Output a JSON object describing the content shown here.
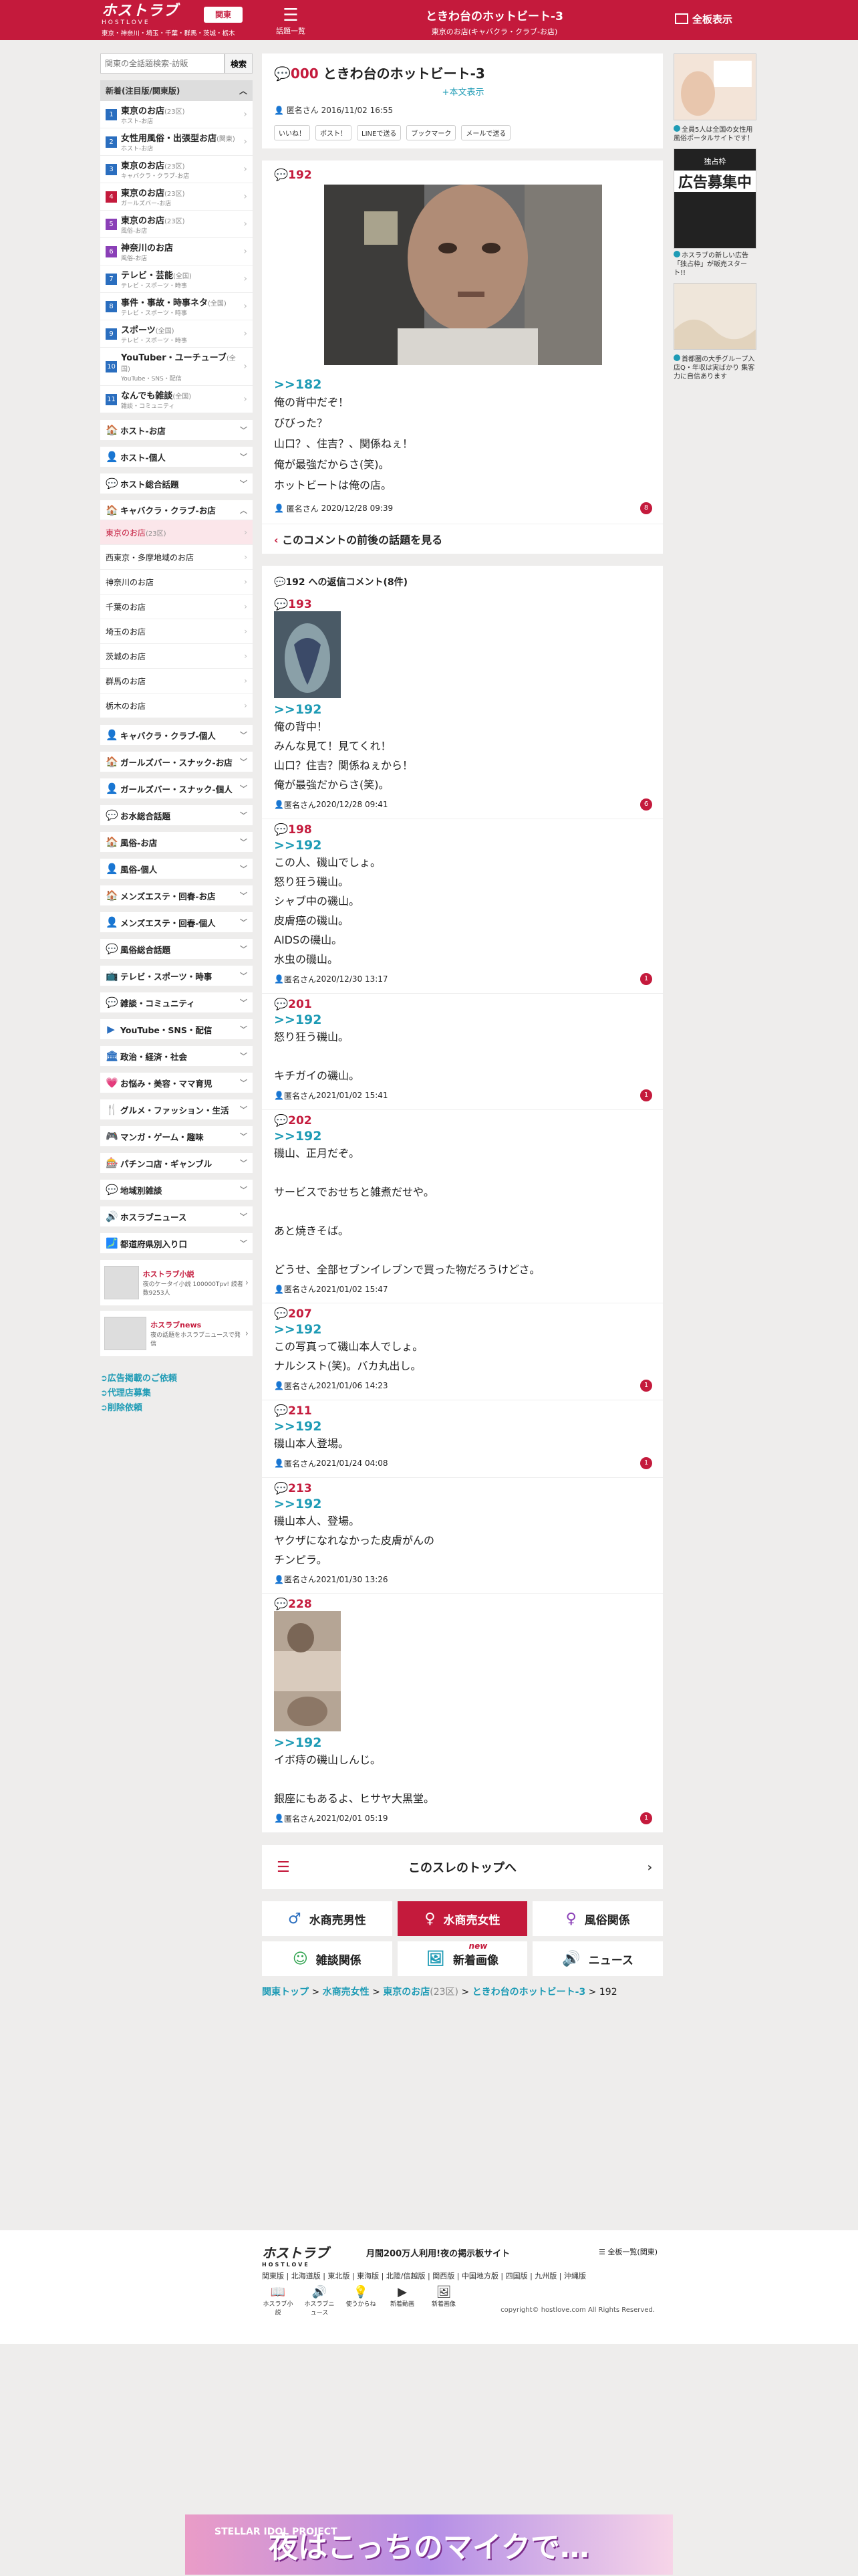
{
  "header": {
    "logo": "ホストラブ",
    "logo_sub": "HOSTLOVE",
    "areas": "東京・神奈川・埼玉・千葉・群馬・茨城・栃木",
    "kanto_btn": "関東",
    "topic_list": "話題一覧",
    "title": "ときわ台のホットビート-3",
    "subtitle": "東京のお店(キャバクラ・クラブ-お店)",
    "full_view": "全板表示"
  },
  "sidebar": {
    "search": {
      "placeholder": "関東の全話題検索-訪販",
      "button": "検索"
    },
    "new_head": "新着(注目版/関東版)",
    "new_items": [
      {
        "num": "1",
        "label": "東京のお店",
        "count": "(23区)",
        "sub": "ホスト-お店",
        "color": "#2a6ebf"
      },
      {
        "num": "2",
        "label": "女性用風俗・出張型お店",
        "count": "(関東)",
        "sub": "ホスト-お店",
        "color": "#2a6ebf"
      },
      {
        "num": "3",
        "label": "東京のお店",
        "count": "(23区)",
        "sub": "キャバクラ・クラブ-お店",
        "color": "#2a6ebf"
      },
      {
        "num": "4",
        "label": "東京のお店",
        "count": "(23区)",
        "sub": "ガールズバー-お店",
        "color": "#c41a3c"
      },
      {
        "num": "5",
        "label": "東京のお店",
        "count": "(23区)",
        "sub": "風俗-お店",
        "color": "#8a3fb7"
      },
      {
        "num": "6",
        "label": "神奈川のお店",
        "count": "",
        "sub": "風俗-お店",
        "color": "#8a3fb7"
      },
      {
        "num": "7",
        "label": "テレビ・芸能",
        "count": "(全国)",
        "sub": "テレビ・スポーツ・時事",
        "color": "#2a6ebf"
      },
      {
        "num": "8",
        "label": "事件・事故・時事ネタ",
        "count": "(全国)",
        "sub": "テレビ・スポーツ・時事",
        "color": "#2a6ebf"
      },
      {
        "num": "9",
        "label": "スポーツ",
        "count": "(全国)",
        "sub": "テレビ・スポーツ・時事",
        "color": "#2a6ebf"
      },
      {
        "num": "10",
        "label": "YouTuber・ユーチューブ",
        "count": "(全国)",
        "sub": "YouTube・SNS・配信",
        "color": "#2a6ebf"
      },
      {
        "num": "11",
        "label": "なんでも雑談",
        "count": "(全国)",
        "sub": "雑談・コミュニティ",
        "color": "#2a6ebf"
      }
    ],
    "cats_a": [
      {
        "icon": "🏠",
        "label": "ホスト-お店",
        "color": "#2a6ebf"
      },
      {
        "icon": "👤",
        "label": "ホスト-個人",
        "color": "#2a6ebf"
      },
      {
        "icon": "💬",
        "label": "ホスト総合話題",
        "color": "#2a6ebf"
      }
    ],
    "kyaba": {
      "icon": "🏠",
      "label": "キャバクラ・クラブ-お店",
      "color": "#c41a3c",
      "items": [
        {
          "label": "東京のお店",
          "count": "(23区)",
          "active": true
        },
        {
          "label": "西東京・多摩地域のお店",
          "count": ""
        },
        {
          "label": "神奈川のお店",
          "count": ""
        },
        {
          "label": "千葉のお店",
          "count": ""
        },
        {
          "label": "埼玉のお店",
          "count": ""
        },
        {
          "label": "茨城のお店",
          "count": ""
        },
        {
          "label": "群馬のお店",
          "count": ""
        },
        {
          "label": "栃木のお店",
          "count": ""
        }
      ]
    },
    "cats_b": [
      {
        "icon": "👤",
        "label": "キャバクラ・クラブ-個人",
        "color": "#c41a3c"
      },
      {
        "icon": "🏠",
        "label": "ガールズバー・スナック-お店",
        "color": "#c41a3c"
      },
      {
        "icon": "👤",
        "label": "ガールズバー・スナック-個人",
        "color": "#c41a3c"
      },
      {
        "icon": "💬",
        "label": "お水総合話題",
        "color": "#c41a3c"
      },
      {
        "icon": "🏠",
        "label": "風俗-お店",
        "color": "#8a3fb7"
      },
      {
        "icon": "👤",
        "label": "風俗-個人",
        "color": "#8a3fb7"
      },
      {
        "icon": "🏠",
        "label": "メンズエステ・回春-お店",
        "color": "#8a3fb7"
      },
      {
        "icon": "👤",
        "label": "メンズエステ・回春-個人",
        "color": "#8a3fb7"
      },
      {
        "icon": "💬",
        "label": "風俗総合話題",
        "color": "#8a3fb7"
      },
      {
        "icon": "📺",
        "label": "テレビ・スポーツ・時事",
        "color": "#2aa04a"
      },
      {
        "icon": "💬",
        "label": "雑談・コミュニティ",
        "color": "#2aa04a"
      },
      {
        "icon": "▶",
        "label": "YouTube・SNS・配信",
        "color": "#2a6ebf"
      },
      {
        "icon": "🏛",
        "label": "政治・経済・社会",
        "color": "#2a6ebf"
      },
      {
        "icon": "💗",
        "label": "お悩み・美容・ママ育児",
        "color": "#c41a3c"
      },
      {
        "icon": "🍴",
        "label": "グルメ・ファッション・生活",
        "color": "#c41a3c"
      },
      {
        "icon": "🎮",
        "label": "マンガ・ゲーム・趣味",
        "color": "#c41a3c"
      },
      {
        "icon": "🎰",
        "label": "パチンコ店・ギャンブル",
        "color": "#c41a3c"
      },
      {
        "icon": "💬",
        "label": "地域別雑談",
        "color": "#e08a1e"
      },
      {
        "icon": "🔊",
        "label": "ホスラブニュース",
        "color": "#333333"
      },
      {
        "icon": "🗾",
        "label": "都道府県別入り口",
        "color": "#2a6ebf"
      }
    ],
    "banners": [
      {
        "title": "ホストラブ小説",
        "desc": "夜のケータイ小説 100000Tpv! 読者数9253人"
      },
      {
        "title": "ホスラブnews",
        "desc": "夜の話題をホスラブニュースで発信"
      }
    ],
    "links": [
      "広告掲載のご依頼",
      "代理店募集",
      "削除依頼"
    ]
  },
  "thread": {
    "num": "000",
    "title": "ときわ台のホットビート-3",
    "show_body": "+本文表示",
    "author": "匿名さん",
    "date": "2016/11/02 16:55",
    "share": [
      "いいね！",
      "ポスト！",
      "LINEで送る",
      "ブックマーク",
      "メールで送る"
    ]
  },
  "post": {
    "num": "192",
    "ref": ">>182",
    "text": "俺の背中だぞ！\nびびった？\n山口？、住吉？、関係ねぇ！\n俺が最強だからさ(笑)。\nホットビートは俺の店。",
    "author": "匿名さん",
    "date": "2020/12/28 09:39",
    "badge": "8",
    "before_label": "このコメントの前後の話題を見る"
  },
  "replies_head": "192 への返信コメント(8件)",
  "replies": [
    {
      "num": "193",
      "ref": ">>192",
      "text": "俺の背中！\nみんな見て！見てくれ！\n山口？住吉？関係ねぇから！\n俺が最強だからさ(笑)。",
      "author": "匿名さん",
      "date": "2020/12/28 09:41",
      "badge": "6",
      "img": true
    },
    {
      "num": "198",
      "ref": ">>192",
      "text": "この人、磯山でしょ。\n怒り狂う磯山。\nシャブ中の磯山。\n皮膚癌の磯山。\nAIDSの磯山。\n水虫の磯山。",
      "author": "匿名さん",
      "date": "2020/12/30 13:17",
      "badge": "1"
    },
    {
      "num": "201",
      "ref": ">>192",
      "text": "怒り狂う磯山。\n\nキチガイの磯山。",
      "author": "匿名さん",
      "date": "2021/01/02 15:41",
      "badge": "1"
    },
    {
      "num": "202",
      "ref": ">>192",
      "text": "磯山、正月だぞ。\n\nサービスでおせちと雑煮だせや。\n\nあと焼きそば。\n\nどうせ、全部セブンイレブンで買った物だろうけどさ。",
      "author": "匿名さん",
      "date": "2021/01/02 15:47",
      "badge": ""
    },
    {
      "num": "207",
      "ref": ">>192",
      "text": "この写真って磯山本人でしょ。\nナルシスト(笑)。バカ丸出し。",
      "author": "匿名さん",
      "date": "2021/01/06 14:23",
      "badge": "1"
    },
    {
      "num": "211",
      "ref": ">>192",
      "text": "磯山本人登場。",
      "author": "匿名さん",
      "date": "2021/01/24 04:08",
      "badge": "1"
    },
    {
      "num": "213",
      "ref": ">>192",
      "text": "磯山本人、登場。\nヤクザになれなかった皮膚がんの\nチンピラ。",
      "author": "匿名さん",
      "date": "2021/01/30 13:26",
      "badge": ""
    },
    {
      "num": "228",
      "ref": ">>192",
      "text": "イボ痔の磯山しんじ。\n\n銀座にもあるよ、ヒサヤ大黒堂。",
      "author": "匿名さん",
      "date": "2021/02/01 05:19",
      "badge": "1",
      "img2": true
    }
  ],
  "to_top": "このスレのトップへ",
  "navgrid": [
    {
      "icon": "♂",
      "label": "水商売男性",
      "active": false,
      "color": "#2a6ebf"
    },
    {
      "icon": "♀",
      "label": "水商売女性",
      "active": true,
      "color": "#ffffff"
    },
    {
      "icon": "♀",
      "label": "風俗関係",
      "active": false,
      "color": "#8a3fb7"
    },
    {
      "icon": "☺",
      "label": "雑談関係",
      "active": false,
      "color": "#2aa04a"
    },
    {
      "icon": "🖼",
      "label": "新着画像",
      "active": false,
      "color": "#1e9bb5",
      "new": "new"
    },
    {
      "icon": "🔊",
      "label": "ニュース",
      "active": false,
      "color": "#333333"
    }
  ],
  "breadcrumb": {
    "a1": "関東トップ",
    "a2": "水商売女性",
    "a3": "東京のお店",
    "a3c": "(23区)",
    "a4": "ときわ台のホットビート-3",
    "tail": "192"
  },
  "footer": {
    "logo": "ホストラブ",
    "logo_sub": "HOSTLOVE",
    "tagline": "月間200万人利用!夜の掲示板サイト",
    "all": "全板一覧(関東)",
    "areas": "関東版 | 北海道版 | 東北版 | 東海版 | 北陸/信越版 | 関西版 | 中国地方版 | 四国版 | 九州版 | 沖縄版",
    "icons": [
      {
        "i": "📖",
        "l": "ホスラブ小説"
      },
      {
        "i": "🔊",
        "l": "ホスラブニュース"
      },
      {
        "i": "💡",
        "l": "使うからね"
      },
      {
        "i": "▶",
        "l": "新着動画"
      },
      {
        "i": "🖼",
        "l": "新着画像"
      }
    ],
    "copy": "copyright© hostlove.com All Rights Reserved."
  },
  "right_ads": [
    {
      "text": "全員5人は全国の女性用風俗ポータルサイトです！"
    },
    {
      "title": "独占枠",
      "big": "広告募集中",
      "sub": "ホスラブの新しい広告「独占枠」が販売スタート!!"
    },
    {
      "text": "首都圏の大手グループ入店Q・年収は実ばかり 集客力に自信あります"
    }
  ],
  "bottom_ad": {
    "brand": "STELLAR IDOL PROJECT",
    "headline": "夜はこっちのマイクで…"
  }
}
